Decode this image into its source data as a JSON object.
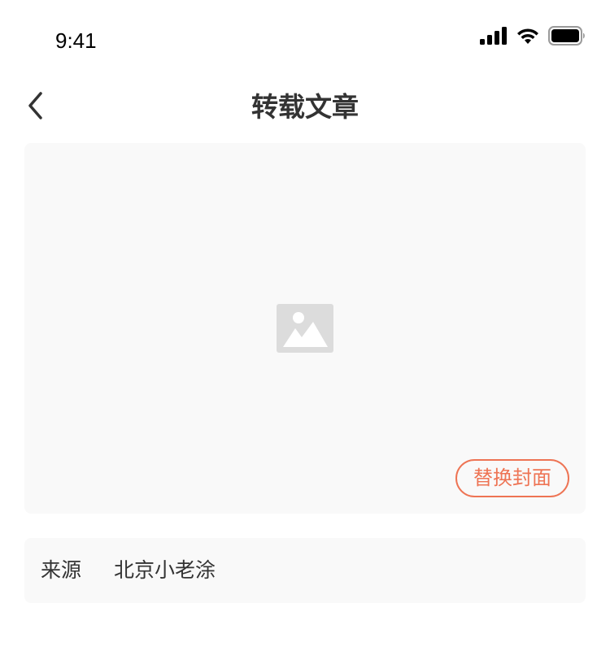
{
  "status_bar": {
    "time": "9:41",
    "icons": [
      "cellular-signal-icon",
      "wifi-icon",
      "battery-icon"
    ]
  },
  "nav": {
    "back_icon": "chevron-left-icon",
    "title": "转载文章"
  },
  "cover": {
    "placeholder_icon": "image-placeholder-icon",
    "replace_label": "替换封面",
    "accent_color": "#ee7454"
  },
  "source": {
    "label": "来源",
    "value": "北京小老涂"
  }
}
